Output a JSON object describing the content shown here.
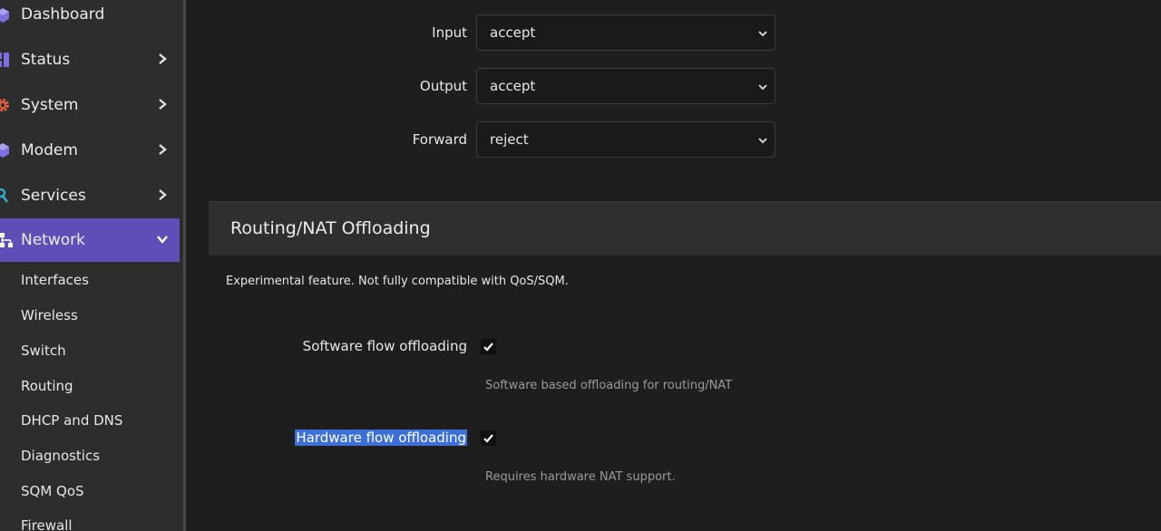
{
  "sidebar": {
    "items": [
      {
        "label": "Dashboard",
        "icon": "cube-icon",
        "icon_color": "#7b70e0"
      },
      {
        "label": "Status",
        "icon": "status-icon",
        "icon_color": "#7b70e0"
      },
      {
        "label": "System",
        "icon": "gear-icon",
        "icon_color": "#e8603c"
      },
      {
        "label": "Modem",
        "icon": "cube-icon",
        "icon_color": "#7b70e0"
      },
      {
        "label": "Services",
        "icon": "services-icon",
        "icon_color": "#2ab3d4"
      },
      {
        "label": "Network",
        "icon": "network-icon",
        "icon_color": "#ffffff"
      }
    ],
    "network_submenu": [
      "Interfaces",
      "Wireless",
      "Switch",
      "Routing",
      "DHCP and DNS",
      "Diagnostics",
      "SQM QoS",
      "Firewall"
    ],
    "active_color": "#5e4fb8"
  },
  "policies": [
    {
      "label": "Input",
      "value": "accept"
    },
    {
      "label": "Output",
      "value": "accept"
    },
    {
      "label": "Forward",
      "value": "reject"
    }
  ],
  "offloading": {
    "title": "Routing/NAT Offloading",
    "description": "Experimental feature. Not fully compatible with QoS/SQM.",
    "software": {
      "label": "Software flow offloading",
      "checked": true,
      "hint": "Software based offloading for routing/NAT"
    },
    "hardware": {
      "label": "Hardware flow offloading",
      "checked": true,
      "hint": "Requires hardware NAT support."
    },
    "selection_color": "#3d6fd8"
  }
}
